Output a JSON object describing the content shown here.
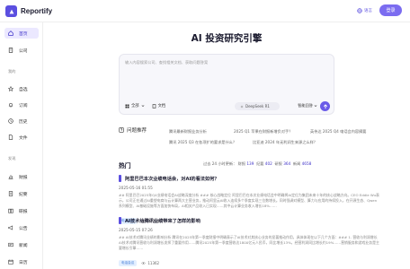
{
  "app": {
    "name": "Reportify",
    "accent": "#5b4fe0"
  },
  "header": {
    "lang_label": "语言",
    "login_label": "登录"
  },
  "sidebar": {
    "items": [
      {
        "label": "首页",
        "icon": "home-icon",
        "active": true
      },
      {
        "label": "公司",
        "icon": "building-icon",
        "active": false
      }
    ],
    "section_mine": "我的",
    "mine_items": [
      {
        "label": "自选",
        "icon": "star-icon"
      },
      {
        "label": "订阅",
        "icon": "bell-icon"
      },
      {
        "label": "历史",
        "icon": "clock-icon"
      },
      {
        "label": "文件",
        "icon": "file-icon"
      }
    ],
    "section_discover": "发现",
    "discover_items": [
      {
        "label": "财报",
        "icon": "chart-icon"
      },
      {
        "label": "纪要",
        "icon": "doc-icon"
      },
      {
        "label": "研报",
        "icon": "book-icon"
      },
      {
        "label": "公告",
        "icon": "megaphone-icon"
      },
      {
        "label": "新闻",
        "icon": "news-icon"
      },
      {
        "label": "日历",
        "icon": "calendar-icon"
      }
    ]
  },
  "main": {
    "title": "AI 投资研究引擎",
    "search": {
      "placeholder": "输入内容搜索公司、查找相关文档、获取问题答案",
      "tool_all": "全部",
      "tool_doc": "文档",
      "model": "DeepSeek R1",
      "think": "智能回答"
    },
    "questions_label": "问题推荐",
    "questions": [
      "腾讯最新财报业务分析",
      "2025 Q1 苹果在财报新增负对手？",
      "英伟达 2025 Q4 电话会内容摘要",
      "腾讯 2025 Q3 在各项扩的要求是什么？",
      "比亚迪 2024 年无利润生来源之么样？"
    ],
    "hot": {
      "title": "热门",
      "stats_prefix": "过去 24 小时更新：",
      "stats": [
        {
          "label": "财报",
          "value": "139"
        },
        {
          "label": "纪要",
          "value": "402"
        },
        {
          "label": "研报",
          "value": "364"
        },
        {
          "label": "新闻",
          "value": "4658"
        }
      ]
    },
    "articles": [
      {
        "title": "阿里巴巴本次业绩电话会，对AI的看法如何？",
        "date": "2025-05-16 01:55",
        "body": "## 阿里巴巴2025年Q4业绩电话会AI战略深度分析 ### 核心战略定位 阿里巴巴在本次业绩电话会中明确将AI定位为集团未来十年的核心战略方向。CEO Eddie Wu表示，公司正在通过AI重塑电商与云计算两大主营业务，推动阿里云AI收入连续多个季度实现三位数增长。同时强调对模型、算力与应用的持续投入，在开源生态、Qwen系列模型、AI基础设施等方面加快布局，AI相关产品收入已实现……其中云计算业务收入增长18%……",
        "tag": "电话会议",
        "views": "37006"
      },
      {
        "title": "AI技术给腾讯业绩带来了怎样的影响",
        "date": "2025-05-15 07:26",
        "body": "## AI技术对腾讯业绩的影响分析 腾讯在2025年第一季度财报中明确表示了AI技术对其核心业务的显著推动作用，具体体现在以下几个方面：### 1. 营收与利润增长 AI技术对腾讯营收与利润增长发挥了重要作用……腾讯2025年第一季度营收达1800亿元人民币，同比增长13%，经营利润同比增长约19%……营销服务和游戏业务是主要增长引擎……",
        "tag": "电话会议",
        "views": "11362"
      }
    ]
  }
}
